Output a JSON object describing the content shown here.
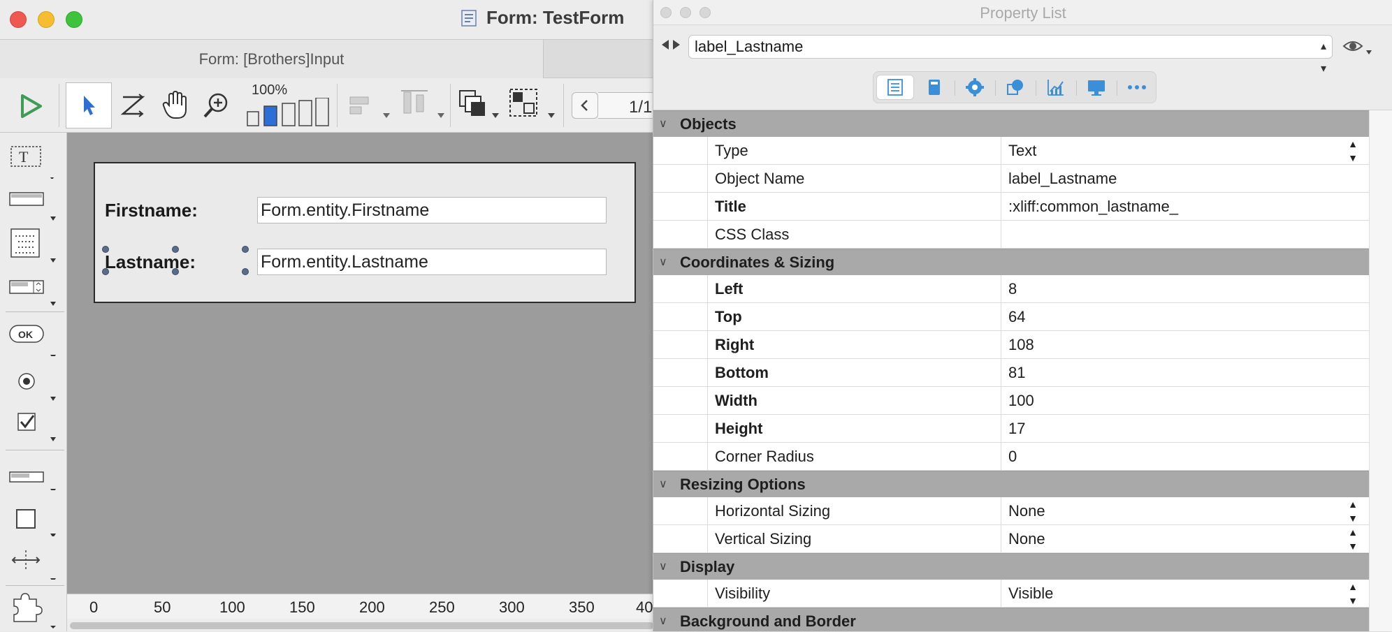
{
  "main_window": {
    "title": "Form: TestForm",
    "tab_label": "Form: [Brothers]Input",
    "zoom": "100%",
    "page_indicator": "1/1",
    "colors": {
      "close": "#ee5a52",
      "minimize": "#f5bd2f",
      "maximize": "#3fc33c",
      "run": "#3e9c57"
    }
  },
  "form": {
    "rows": [
      {
        "label": "Firstname:",
        "field": "Form.entity.Firstname"
      },
      {
        "label": "Lastname:",
        "field": "Form.entity.Lastname"
      }
    ]
  },
  "ruler": {
    "ticks": [
      "0",
      "50",
      "100",
      "150",
      "200",
      "250",
      "300",
      "350",
      "40"
    ]
  },
  "palette": {
    "items": [
      "text-tool-icon",
      "input-tool-icon",
      "list-tool-icon",
      "combo-tool-icon",
      "button-tool-icon",
      "radio-tool-icon",
      "checkbox-tool-icon",
      "progress-tool-icon",
      "rectangle-tool-icon",
      "splitter-tool-icon",
      "plugin-tool-icon"
    ],
    "ok_label": "OK"
  },
  "property_list": {
    "title": "Property List",
    "selected_object": "label_Lastname",
    "tabs": [
      "list-icon",
      "document-icon",
      "gear-icon",
      "shapes-icon",
      "chart-icon",
      "display-icon",
      "more-icon"
    ],
    "sections": [
      {
        "name": "Objects",
        "rows": [
          {
            "label": "Type",
            "value": "Text",
            "bold": false,
            "dropdown": true
          },
          {
            "label": "Object Name",
            "value": "label_Lastname",
            "bold": false,
            "dropdown": false
          },
          {
            "label": "Title",
            "value": ":xliff:common_lastname_",
            "bold": true,
            "dropdown": false
          },
          {
            "label": "CSS Class",
            "value": "",
            "bold": false,
            "dropdown": false
          }
        ]
      },
      {
        "name": "Coordinates & Sizing",
        "rows": [
          {
            "label": "Left",
            "value": "8",
            "bold": true,
            "dropdown": false
          },
          {
            "label": "Top",
            "value": "64",
            "bold": true,
            "dropdown": false
          },
          {
            "label": "Right",
            "value": "108",
            "bold": true,
            "dropdown": false
          },
          {
            "label": "Bottom",
            "value": "81",
            "bold": true,
            "dropdown": false
          },
          {
            "label": "Width",
            "value": "100",
            "bold": true,
            "dropdown": false
          },
          {
            "label": "Height",
            "value": "17",
            "bold": true,
            "dropdown": false
          },
          {
            "label": "Corner Radius",
            "value": "0",
            "bold": false,
            "dropdown": false
          }
        ]
      },
      {
        "name": "Resizing Options",
        "rows": [
          {
            "label": "Horizontal Sizing",
            "value": "None",
            "bold": false,
            "dropdown": true
          },
          {
            "label": "Vertical Sizing",
            "value": "None",
            "bold": false,
            "dropdown": true
          }
        ]
      },
      {
        "name": "Display",
        "rows": [
          {
            "label": "Visibility",
            "value": "Visible",
            "bold": false,
            "dropdown": true
          }
        ]
      },
      {
        "name": "Background and Border",
        "rows": []
      }
    ]
  }
}
